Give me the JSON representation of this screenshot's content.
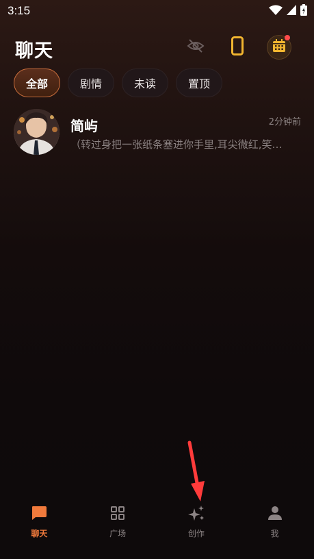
{
  "status_bar": {
    "time": "3:15"
  },
  "header": {
    "title": "聊天"
  },
  "tabs": [
    {
      "label": "全部",
      "active": true
    },
    {
      "label": "剧情",
      "active": false
    },
    {
      "label": "未读",
      "active": false
    },
    {
      "label": "置顶",
      "active": false
    }
  ],
  "chats": [
    {
      "name": "简屿",
      "time": "2分钟前",
      "preview": "（转过身把一张纸条塞进你手里,耳尖微红,笑…"
    }
  ],
  "bottom_nav": [
    {
      "label": "聊天",
      "icon": "chat-icon",
      "active": true
    },
    {
      "label": "广场",
      "icon": "grid-icon",
      "active": false
    },
    {
      "label": "创作",
      "icon": "sparkle-icon",
      "active": false
    },
    {
      "label": "我",
      "icon": "person-icon",
      "active": false
    }
  ],
  "colors": {
    "accent": "#f07a3c",
    "icon_gold": "#f2b630",
    "notify_dot": "#ff4b4b",
    "arrow": "#ff3b3b"
  }
}
